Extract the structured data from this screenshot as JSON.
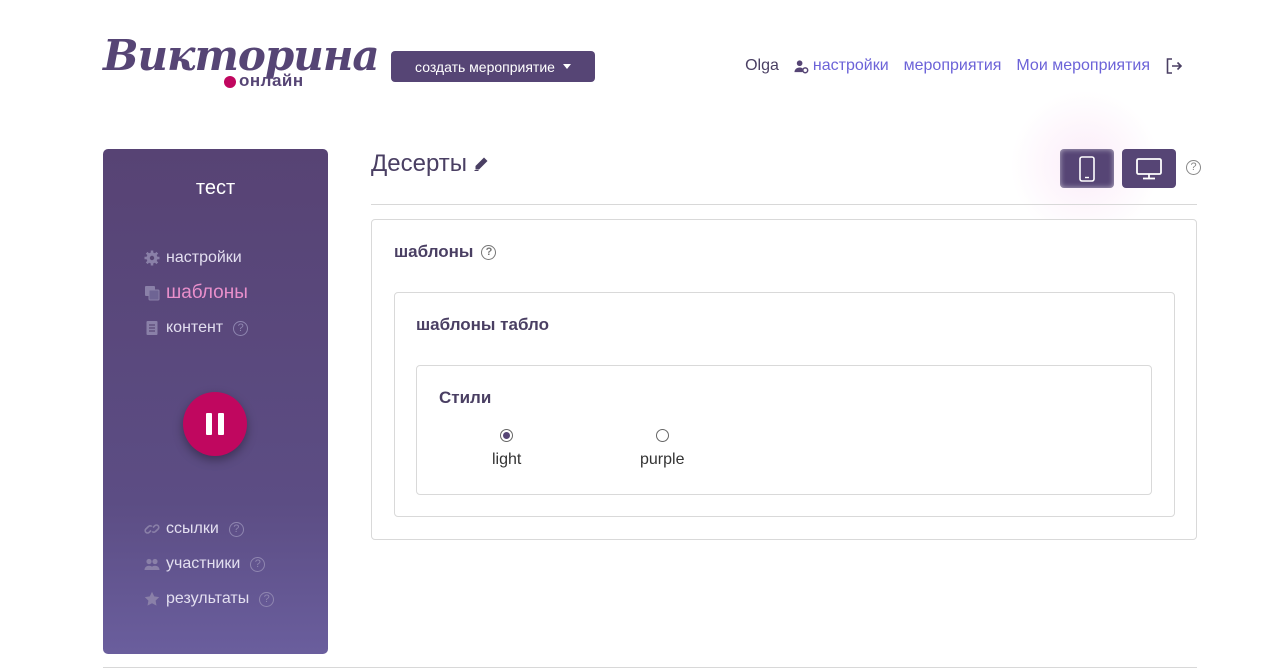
{
  "header": {
    "logo_main": "Викторина",
    "logo_sub": "онлайн",
    "create_button": "создать мероприятие",
    "user_name": "Olga",
    "nav": {
      "settings": "настройки",
      "events": "мероприятия",
      "my_events": "Мои мероприятия"
    }
  },
  "sidebar": {
    "title": "тест",
    "items": [
      {
        "label": "настройки",
        "icon": "gear-icon"
      },
      {
        "label": "шаблоны",
        "icon": "copy-icon"
      },
      {
        "label": "контент",
        "icon": "document-icon"
      },
      {
        "label": "ссылки",
        "icon": "link-icon"
      },
      {
        "label": "участники",
        "icon": "users-icon"
      },
      {
        "label": "результаты",
        "icon": "star-icon"
      }
    ],
    "help": "?"
  },
  "main": {
    "title": "Десерты",
    "help": "?",
    "templates_title": "шаблоны",
    "board_templates_title": "шаблоны табло",
    "styles_title": "Стили",
    "styles": [
      {
        "label": "light",
        "selected": true
      },
      {
        "label": "purple",
        "selected": false
      }
    ]
  },
  "colors": {
    "primary": "#564575",
    "accent": "#c0075f",
    "link": "#6c63d8",
    "active_item": "#e98fcb"
  }
}
